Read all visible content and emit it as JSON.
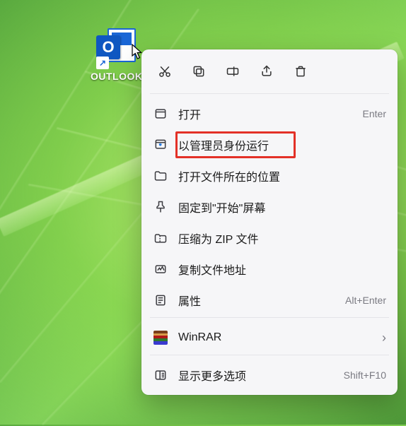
{
  "desktop": {
    "icon_label": "OUTLOOK",
    "icon_letter": "O",
    "shortcut_glyph": "↗"
  },
  "toolbar": {
    "cut": "cut",
    "copy": "copy",
    "rename": "rename",
    "share": "share",
    "delete": "delete"
  },
  "menu": {
    "open": {
      "label": "打开",
      "accel": "Enter"
    },
    "run_admin": {
      "label": "以管理员身份运行"
    },
    "open_location": {
      "label": "打开文件所在的位置"
    },
    "pin_start": {
      "label": "固定到\"开始\"屏幕"
    },
    "compress_zip": {
      "label": "压缩为 ZIP 文件"
    },
    "copy_path": {
      "label": "复制文件地址"
    },
    "properties": {
      "label": "属性",
      "accel": "Alt+Enter"
    },
    "winrar": {
      "label": "WinRAR",
      "sub": "›"
    },
    "more_options": {
      "label": "显示更多选项",
      "accel": "Shift+F10"
    }
  },
  "highlighted_item": "run_admin"
}
